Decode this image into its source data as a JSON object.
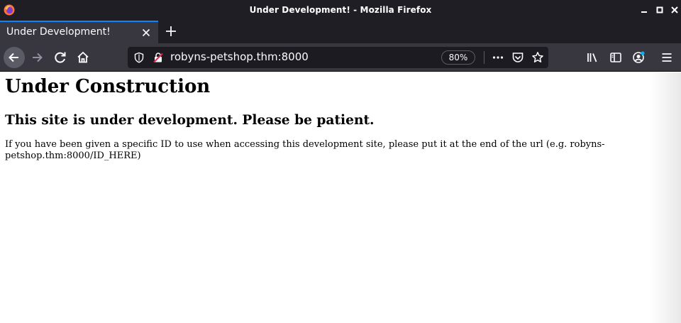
{
  "window": {
    "title": "Under Development! - Mozilla Firefox"
  },
  "tabs": [
    {
      "label": "Under Development!",
      "active": true
    }
  ],
  "toolbar": {
    "url": "robyns-petshop.thm:8000",
    "zoom": "80%"
  },
  "page": {
    "heading": "Under Construction",
    "subheading": "This site is under development. Please be patient.",
    "paragraph": "If you have been given a specific ID to use when accessing this development site, please put it at the end of the url (e.g. robyns-petshop.thm:8000/ID_HERE)"
  },
  "icons": {
    "app_logo": "firefox-icon",
    "back": "back-arrow-icon",
    "forward": "forward-arrow-icon",
    "reload": "reload-icon",
    "home": "home-icon",
    "tracking": "shield-icon",
    "insecure": "insecure-lock-icon",
    "page_actions": "more-icon",
    "pocket": "pocket-icon",
    "bookmark": "star-icon",
    "library": "library-icon",
    "sidebar": "sidebar-icon",
    "account": "account-icon",
    "menu": "hamburger-menu-icon"
  },
  "colors": {
    "titlebar_bg": "#1f1e25",
    "toolbar_bg": "#38373f",
    "urlbar_bg": "#1c1b22",
    "tab_accent": "#0a84ff",
    "account_badge": "#00b3f4"
  }
}
